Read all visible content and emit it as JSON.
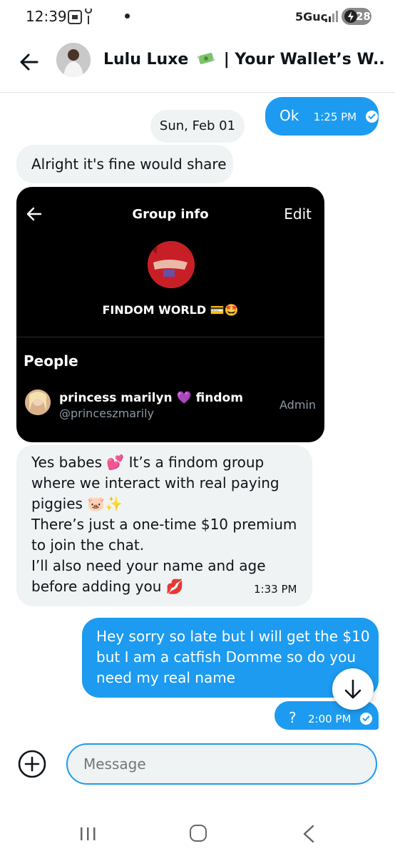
{
  "status_bar": {
    "time": "12:39",
    "network": "5Guc",
    "battery": "28"
  },
  "header": {
    "title_name": "Lulu Luxe",
    "title_rest": "| Your Wallet’s W...",
    "title_icon": "money-with-wings-icon"
  },
  "messages": {
    "ok_text": "Ok",
    "ok_time": "1:25 PM",
    "date_separator": "Sun, Feb 01",
    "alright_text": "Alright it's fine would share",
    "card": {
      "title": "Group info",
      "edit": "Edit",
      "group_name": "FINDOM WORLD 💳🤩",
      "people_header": "People",
      "member_name": "princess marilyn 💜 findom",
      "member_handle": "@princeszmarily",
      "member_role": "Admin"
    },
    "reply_lines": [
      "Yes babes 💕 It’s a findom group",
      "where we interact with real paying",
      "piggies 🐷✨",
      "There’s just a one-time $10 premium",
      "to join the chat.",
      "I’ll also need your name and age",
      "before adding you 💋"
    ],
    "reply_time": "1:33 PM",
    "sent_lines": [
      "Hey sorry so late but I will get the $10",
      "but I am a catfish Domme so do you",
      "need my real name"
    ],
    "question_text": "?",
    "question_time": "2:00 PM"
  },
  "composer": {
    "placeholder": "Message"
  },
  "colors": {
    "accent": "#1d9bf0",
    "received_bubble": "#eff3f4",
    "card_background": "#000000"
  }
}
